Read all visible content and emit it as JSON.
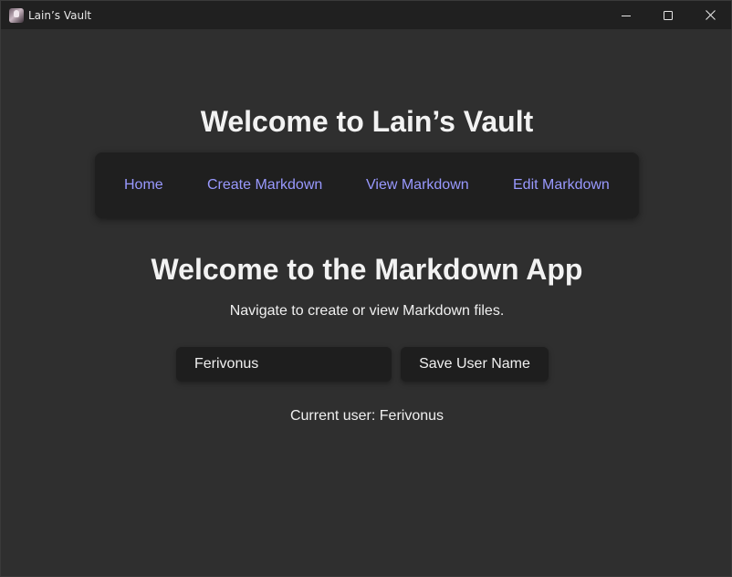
{
  "window": {
    "title": "Lain’s Vault",
    "icon": "lain-avatar-icon"
  },
  "controls": {
    "minimize": "minimize-icon",
    "maximize": "maximize-icon",
    "close": "close-icon"
  },
  "main": {
    "title": "Welcome to Lain’s Vault",
    "subtitle": "Welcome to the Markdown App",
    "description": "Navigate to create or view Markdown files."
  },
  "nav": {
    "items": [
      {
        "label": "Home"
      },
      {
        "label": "Create Markdown"
      },
      {
        "label": "View Markdown"
      },
      {
        "label": "Edit Markdown"
      }
    ]
  },
  "user_form": {
    "input_value": "Ferivonus",
    "save_label": "Save User Name",
    "current_user_prefix": "Current user:",
    "current_user": "Ferivonus"
  },
  "colors": {
    "background": "#2f2f2f",
    "titlebar": "#202020",
    "nav_bg": "#1f1f1f",
    "link": "#9999ff",
    "text": "#f2f2f2"
  }
}
